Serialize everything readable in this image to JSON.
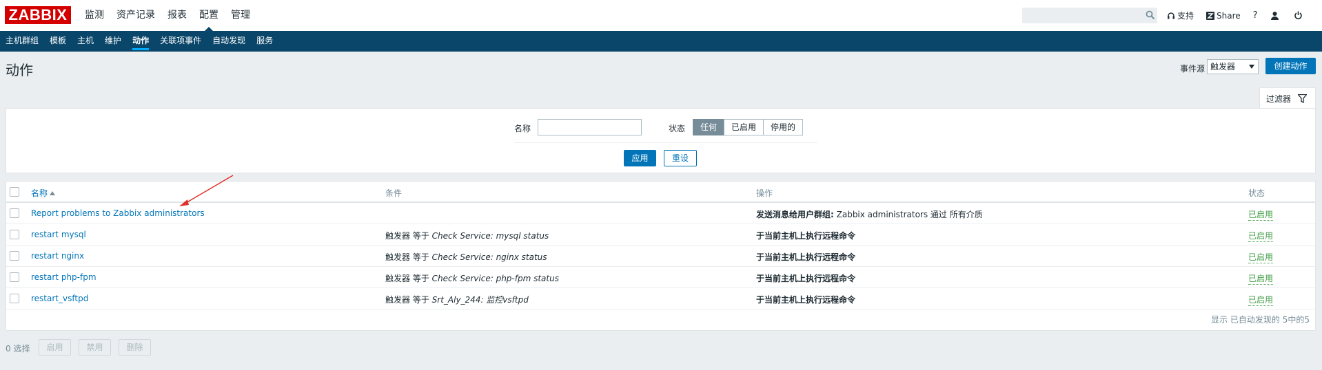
{
  "brand": {
    "logo_text": "ZABBIX",
    "color": "#d40000"
  },
  "main_menu": [
    {
      "label": "监测",
      "selected": false
    },
    {
      "label": "资产记录",
      "selected": false
    },
    {
      "label": "报表",
      "selected": false
    },
    {
      "label": "配置",
      "selected": true
    },
    {
      "label": "管理",
      "selected": false
    }
  ],
  "topbar": {
    "search_placeholder": "",
    "support_label": "支持",
    "share_label": "Share",
    "help_label": "?"
  },
  "submenu": [
    {
      "label": "主机群组",
      "selected": false
    },
    {
      "label": "模板",
      "selected": false
    },
    {
      "label": "主机",
      "selected": false
    },
    {
      "label": "维护",
      "selected": false
    },
    {
      "label": "动作",
      "selected": true
    },
    {
      "label": "关联项事件",
      "selected": false
    },
    {
      "label": "自动发现",
      "selected": false
    },
    {
      "label": "服务",
      "selected": false
    }
  ],
  "header": {
    "title": "动作",
    "event_source_label": "事件源",
    "event_source_value": "触发器",
    "create_button": "创建动作"
  },
  "filter": {
    "tab_label": "过滤器",
    "name_label": "名称",
    "name_value": "",
    "status_label": "状态",
    "status_options": [
      {
        "label": "任何",
        "active": true
      },
      {
        "label": "已启用",
        "active": false
      },
      {
        "label": "停用的",
        "active": false
      }
    ],
    "apply_button": "应用",
    "reset_button": "重设"
  },
  "table": {
    "headers": {
      "name": "名称",
      "conditions": "条件",
      "operations": "操作",
      "status": "状态"
    },
    "rows": [
      {
        "name": "Report problems to Zabbix administrators",
        "cond_prefix": "",
        "cond_value": "",
        "op_bold": "发送消息给用户群组:",
        "op_rest": " Zabbix administrators 通过 所有介质",
        "status": "已启用"
      },
      {
        "name": "restart mysql",
        "cond_prefix": "触发器 等于 ",
        "cond_value": "Check Service: mysql status",
        "op_bold": "于当前主机上执行远程命令",
        "op_rest": "",
        "status": "已启用"
      },
      {
        "name": "restart nginx",
        "cond_prefix": "触发器 等于 ",
        "cond_value": "Check Service: nginx status",
        "op_bold": "于当前主机上执行远程命令",
        "op_rest": "",
        "status": "已启用"
      },
      {
        "name": "restart php-fpm",
        "cond_prefix": "触发器 等于 ",
        "cond_value": "Check Service: php-fpm status",
        "op_bold": "于当前主机上执行远程命令",
        "op_rest": "",
        "status": "已启用"
      },
      {
        "name": "restart_vsftpd",
        "cond_prefix": "触发器 等于 ",
        "cond_value": "Srt_Aly_244: 监控vsftpd",
        "op_bold": "于当前主机上执行远程命令",
        "op_rest": "",
        "status": "已启用"
      }
    ],
    "footer": "显示 已自动发现的 5中的5"
  },
  "bottom_bar": {
    "selected_count": "0 选择",
    "enable_button": "启用",
    "disable_button": "禁用",
    "delete_button": "删除"
  },
  "colors": {
    "accent": "#0275b8",
    "nav": "#0a466a",
    "enabled": "#429e47",
    "annotation": "#e0302a"
  }
}
